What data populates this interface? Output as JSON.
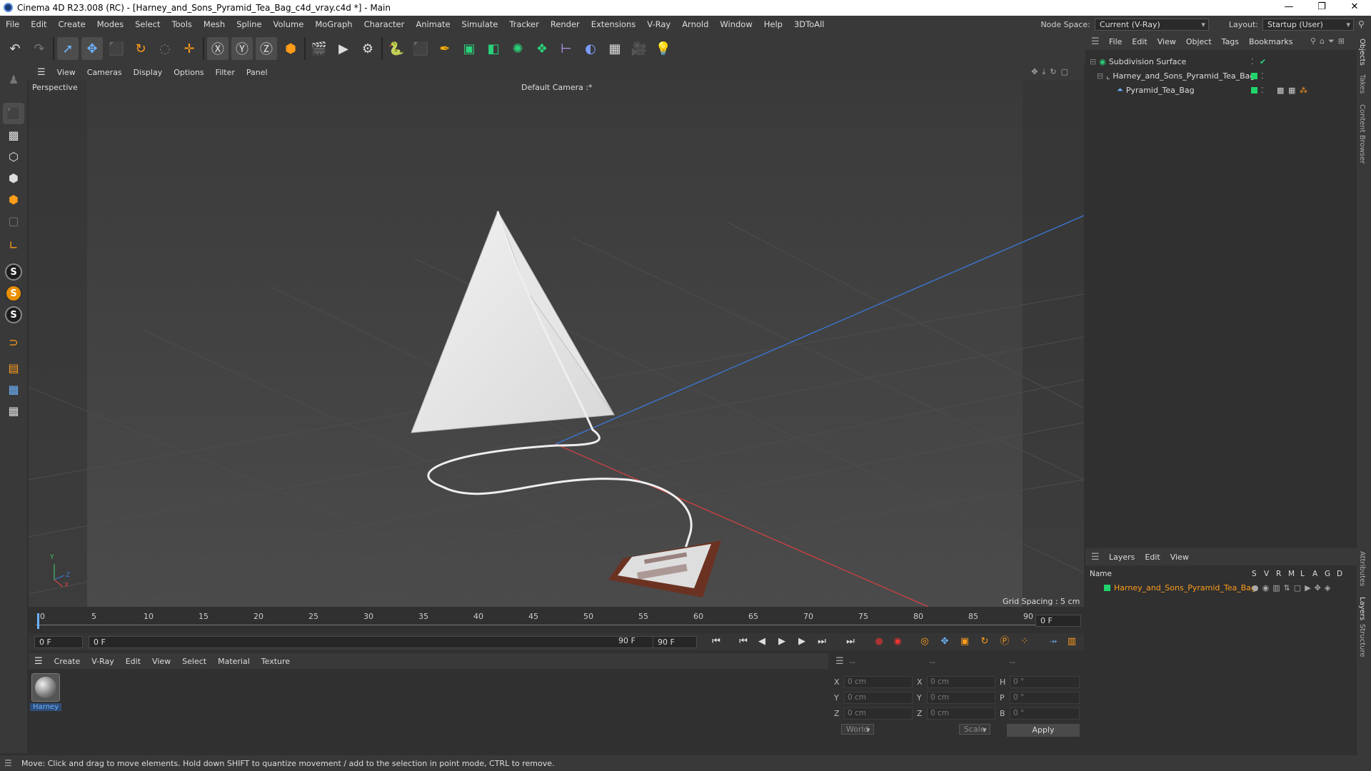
{
  "window": {
    "title": "Cinema 4D R23.008 (RC) - [Harney_and_Sons_Pyramid_Tea_Bag_c4d_vray.c4d *] - Main",
    "min": "—",
    "restore": "❐",
    "close": "✕"
  },
  "menubar": {
    "items": [
      "File",
      "Edit",
      "Create",
      "Modes",
      "Select",
      "Tools",
      "Mesh",
      "Spline",
      "Volume",
      "MoGraph",
      "Character",
      "Animate",
      "Simulate",
      "Tracker",
      "Render",
      "Extensions",
      "V-Ray",
      "Arnold",
      "Window",
      "Help",
      "3DToAll"
    ],
    "node_space_label": "Node Space:",
    "node_space_value": "Current (V-Ray)",
    "layout_label": "Layout:",
    "layout_value": "Startup (User)"
  },
  "viewport": {
    "menu": [
      "View",
      "Cameras",
      "Display",
      "Options",
      "Filter",
      "Panel"
    ],
    "label": "Perspective",
    "camera": "Default Camera :*",
    "grid_spacing": "Grid Spacing : 5 cm",
    "axis_y": "Y",
    "axis_z": "Z",
    "axis_x": "X"
  },
  "timeline": {
    "ticks": [
      "0",
      "5",
      "10",
      "15",
      "20",
      "25",
      "30",
      "35",
      "40",
      "45",
      "50",
      "55",
      "60",
      "65",
      "70",
      "75",
      "80",
      "85",
      "90"
    ],
    "current_frame_right": "0 F",
    "start": "0 F",
    "range_start": "0 F",
    "range_end": "90 F",
    "end": "90 F"
  },
  "materials": {
    "menu": [
      "Create",
      "V-Ray",
      "Edit",
      "View",
      "Select",
      "Material",
      "Texture"
    ],
    "items": [
      {
        "name": "Harney"
      }
    ]
  },
  "coords": {
    "header": [
      "--",
      "--",
      "--"
    ],
    "pos_labels": [
      "X",
      "Y",
      "Z"
    ],
    "size_labels": [
      "X",
      "Y",
      "Z"
    ],
    "rot_labels": [
      "H",
      "P",
      "B"
    ],
    "pos_values": [
      "0 cm",
      "0 cm",
      "0 cm"
    ],
    "size_values": [
      "0 cm",
      "0 cm",
      "0 cm"
    ],
    "rot_values": [
      "0 °",
      "0 °",
      "0 °"
    ],
    "world": "World",
    "scale": "Scale",
    "apply": "Apply"
  },
  "objects": {
    "menu": [
      "File",
      "Edit",
      "View",
      "Object",
      "Tags",
      "Bookmarks"
    ],
    "items": [
      {
        "name": "Subdivision Surface"
      },
      {
        "name": "Harney_and_Sons_Pyramid_Tea_Bag"
      },
      {
        "name": "Pyramid_Tea_Bag"
      }
    ]
  },
  "layers": {
    "menu": [
      "Layers",
      "Edit",
      "View"
    ],
    "name_header": "Name",
    "cols": [
      "S",
      "V",
      "R",
      "M",
      "L",
      "A",
      "G",
      "D"
    ],
    "items": [
      {
        "name": "Harney_and_Sons_Pyramid_Tea_Bag",
        "color": "#1fd46a"
      }
    ]
  },
  "sidetabs": [
    "Objects",
    "Takes",
    "Content Browser",
    "Attributes",
    "Layers",
    "Structure"
  ],
  "status": "Move: Click and drag to move elements. Hold down SHIFT to quantize movement / add to the selection in point mode, CTRL to remove.",
  "colors": {
    "accent": "#ff9c1a",
    "layer_green": "#1fd46a",
    "axis_red": "#d04040",
    "axis_green": "#3fbf5f",
    "axis_blue": "#3b78d8"
  }
}
